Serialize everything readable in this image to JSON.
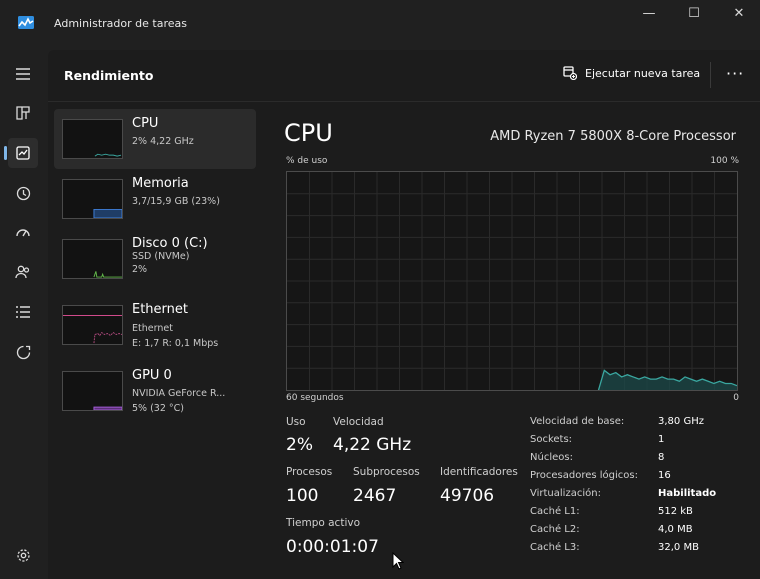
{
  "window": {
    "title": "Administrador de tareas",
    "controls": [
      "—",
      "☐",
      "✕"
    ]
  },
  "header": {
    "title": "Rendimiento",
    "new_task_label": "Ejecutar nueva tarea",
    "more": "···"
  },
  "colors": {
    "cpu": "#3aa7a0",
    "memory": "#3f7fd9",
    "disk": "#62b84a",
    "ethernet": "#d14a8b",
    "gpu": "#a35cd6"
  },
  "resources": [
    {
      "name": "CPU",
      "line1": "2% 4,22 GHz",
      "line2": ""
    },
    {
      "name": "Memoria",
      "line1": "3,7/15,9 GB (23%)",
      "line2": ""
    },
    {
      "name": "Disco 0 (C:)",
      "line1": "SSD (NVMe)",
      "line2": "2%"
    },
    {
      "name": "Ethernet",
      "line1": "Ethernet",
      "line2": "E: 1,7 R: 0,1 Mbps"
    },
    {
      "name": "GPU 0",
      "line1": "NVIDIA GeForce R...",
      "line2": "5% (32 °C)"
    }
  ],
  "main": {
    "title": "CPU",
    "model": "AMD Ryzen 7 5800X 8-Core Processor",
    "usage_label": "% de uso",
    "max_label": "100 %",
    "time_label": "60 segundos",
    "zero_label": "0",
    "utilization_points": [
      0,
      0,
      0,
      0,
      0,
      0,
      0,
      0,
      0,
      0,
      0,
      0,
      0,
      0,
      0,
      0,
      0,
      0,
      0,
      0,
      0,
      0,
      0,
      0,
      0,
      0,
      0,
      0,
      0,
      0,
      0,
      0,
      0,
      0,
      0,
      0,
      0,
      0,
      0,
      0,
      0,
      0,
      0,
      0,
      0,
      0,
      0,
      0,
      0,
      0,
      0,
      0,
      0,
      0,
      0,
      9,
      7,
      8,
      6,
      7,
      6,
      5,
      6,
      5,
      5,
      6,
      5,
      5,
      4,
      6,
      5,
      4,
      5,
      4,
      3,
      4,
      3,
      3,
      2
    ],
    "stats": {
      "usage_label": "Uso",
      "usage_value": "2%",
      "speed_label": "Velocidad",
      "speed_value": "4,22 GHz",
      "processes_label": "Procesos",
      "processes_value": "100",
      "threads_label": "Subprocesos",
      "threads_value": "2467",
      "handles_label": "Identificadores",
      "handles_value": "49706",
      "uptime_label": "Tiempo activo",
      "uptime_value": "0:00:01:07"
    },
    "specs": [
      {
        "key": "Velocidad de base:",
        "value": "3,80 GHz"
      },
      {
        "key": "Sockets:",
        "value": "1"
      },
      {
        "key": "Núcleos:",
        "value": "8"
      },
      {
        "key": "Procesadores lógicos:",
        "value": "16"
      },
      {
        "key": "Virtualización:",
        "value": "Habilitado"
      },
      {
        "key": "Caché L1:",
        "value": "512 kB"
      },
      {
        "key": "Caché L2:",
        "value": "4,0 MB"
      },
      {
        "key": "Caché L3:",
        "value": "32,0 MB"
      }
    ]
  }
}
